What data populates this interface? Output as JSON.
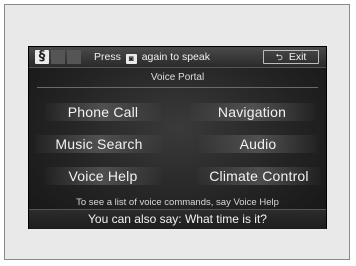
{
  "header": {
    "prompt_before": "Press",
    "prompt_after": "again to speak",
    "exit_label": "Exit"
  },
  "portal_title": "Voice Portal",
  "commands": [
    {
      "label": "Phone Call"
    },
    {
      "label": "Navigation"
    },
    {
      "label": "Music Search"
    },
    {
      "label": "Audio"
    },
    {
      "label": "Voice Help"
    },
    {
      "label": "Climate Control"
    }
  ],
  "hint": "To see a list of voice commands, say Voice Help",
  "also_say": "You can also say: What time is it?",
  "icons": {
    "signal": "voice-signal-icon",
    "talk": "talk-button-icon",
    "back": "back-arrow-icon"
  },
  "colors": {
    "screen_bg": "#222222",
    "text": "#f2f2f2"
  }
}
